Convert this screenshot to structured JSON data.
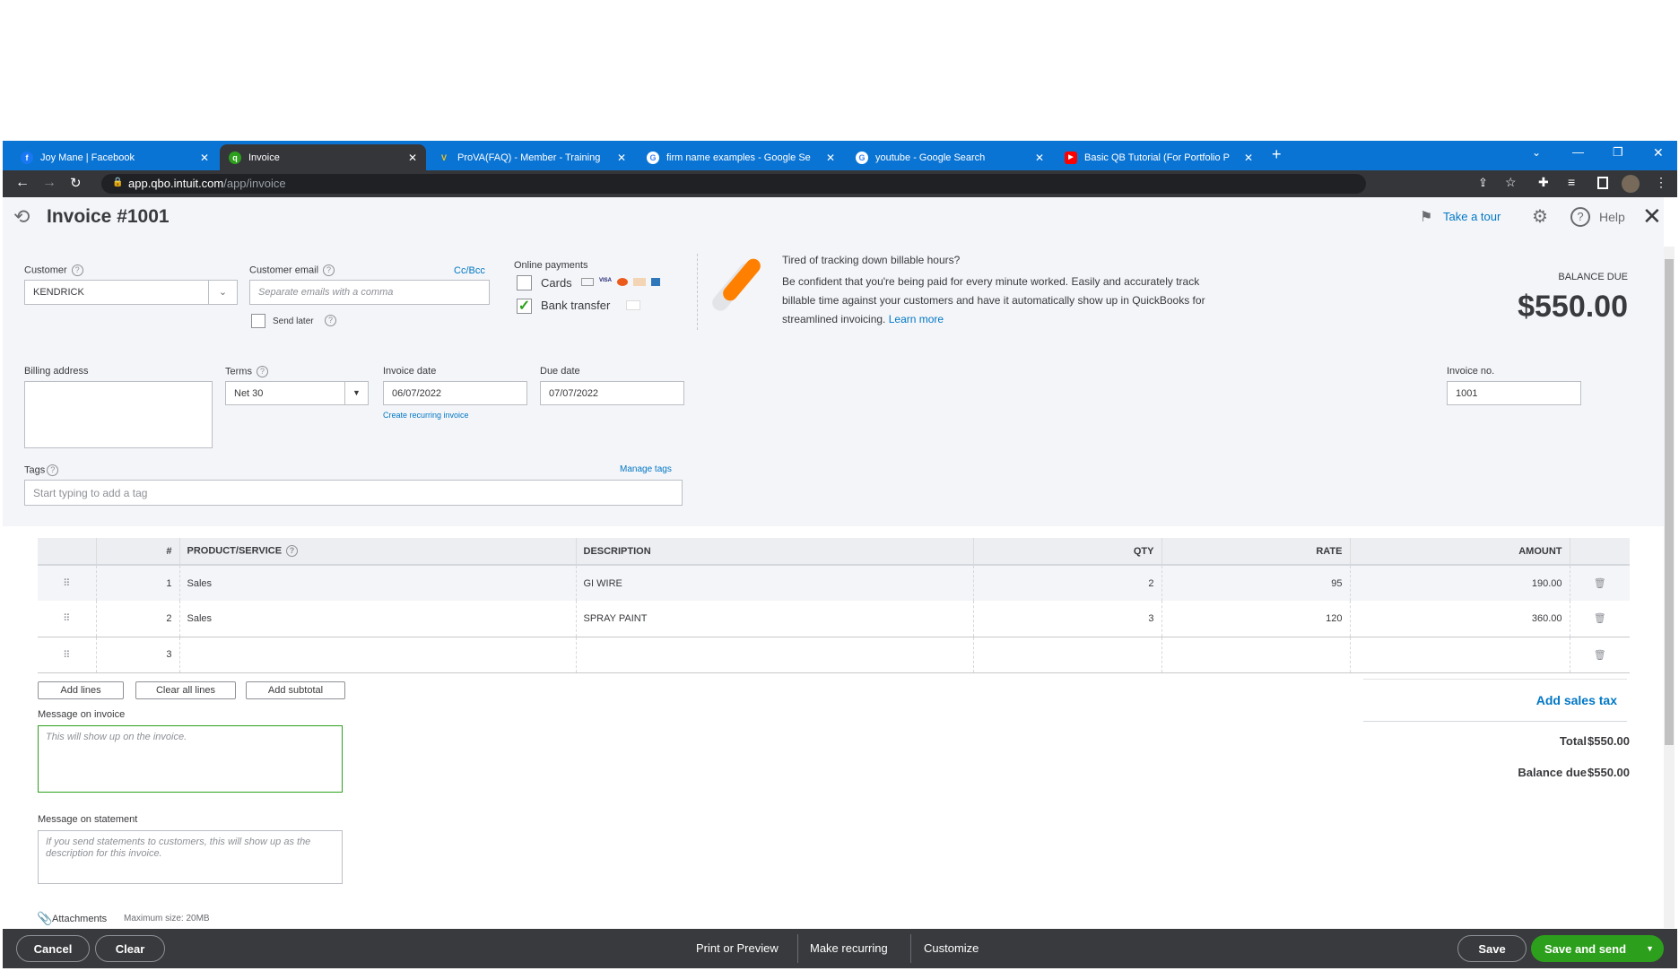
{
  "browser": {
    "tabs": [
      {
        "label": "Joy Mane | Facebook",
        "icon": "facebook-icon"
      },
      {
        "label": "Invoice",
        "icon": "quickbooks-icon",
        "active": true
      },
      {
        "label": "ProVA(FAQ) - Member - Training",
        "icon": "va-icon"
      },
      {
        "label": "firm name examples - Google Se",
        "icon": "google-icon"
      },
      {
        "label": "youtube - Google Search",
        "icon": "google-icon"
      },
      {
        "label": "Basic QB Tutorial (For Portfolio P",
        "icon": "youtube-icon"
      }
    ],
    "url_host": "app.qbo.intuit.com",
    "url_path": "/app/invoice"
  },
  "header": {
    "title": "Invoice #1001",
    "take_tour": "Take a tour",
    "help": "Help"
  },
  "form": {
    "customer_label": "Customer",
    "customer_value": "KENDRICK",
    "email_label": "Customer email",
    "email_placeholder": "Separate emails with a comma",
    "cc_bcc": "Cc/Bcc",
    "send_later": "Send later",
    "online_payments": "Online payments",
    "cards": "Cards",
    "bank_transfer": "Bank transfer",
    "bank_transfer_checked": true,
    "cards_checked": false,
    "billing_label": "Billing address",
    "terms_label": "Terms",
    "terms_value": "Net 30",
    "invoice_date_label": "Invoice date",
    "invoice_date": "06/07/2022",
    "create_recurring": "Create recurring invoice",
    "due_date_label": "Due date",
    "due_date": "07/07/2022",
    "invoice_no_label": "Invoice no.",
    "invoice_no": "1001",
    "tags_label": "Tags",
    "manage_tags": "Manage tags",
    "tags_placeholder": "Start typing to add a tag"
  },
  "promo": {
    "title": "Tired of tracking down billable hours?",
    "body": "Be confident that you're being paid for every minute worked. Easily and accurately track billable time against your customers and have it automatically show up in QuickBooks for streamlined invoicing.",
    "learn_more": "Learn more"
  },
  "balance": {
    "label": "BALANCE DUE",
    "amount": "$550.00"
  },
  "table": {
    "headers": [
      "#",
      "PRODUCT/SERVICE",
      "DESCRIPTION",
      "QTY",
      "RATE",
      "AMOUNT"
    ],
    "rows": [
      {
        "n": "1",
        "product": "Sales",
        "description": "GI WIRE",
        "qty": "2",
        "rate": "95",
        "amount": "190.00"
      },
      {
        "n": "2",
        "product": "Sales",
        "description": "SPRAY PAINT",
        "qty": "3",
        "rate": "120",
        "amount": "360.00"
      },
      {
        "n": "3",
        "product": "",
        "description": "",
        "qty": "",
        "rate": "",
        "amount": ""
      }
    ],
    "add_lines": "Add lines",
    "clear_lines": "Clear all lines",
    "add_subtotal": "Add subtotal"
  },
  "totals": {
    "add_sales_tax": "Add sales tax",
    "total_label": "Total",
    "total": "$550.00",
    "balance_label": "Balance due",
    "balance": "$550.00"
  },
  "messages": {
    "invoice_label": "Message on invoice",
    "invoice_placeholder": "This will show up on the invoice.",
    "statement_label": "Message on statement",
    "statement_placeholder": "If you send statements to customers, this will show up as the description for this invoice.",
    "attachments": "Attachments",
    "max_size": "Maximum size: 20MB"
  },
  "footer": {
    "cancel": "Cancel",
    "clear": "Clear",
    "print": "Print or Preview",
    "recurring": "Make recurring",
    "customize": "Customize",
    "save": "Save",
    "save_send": "Save and send"
  },
  "colors": {
    "brand_green": "#2ca01c",
    "link": "#0077c5",
    "tabbar": "#0a74d4"
  }
}
